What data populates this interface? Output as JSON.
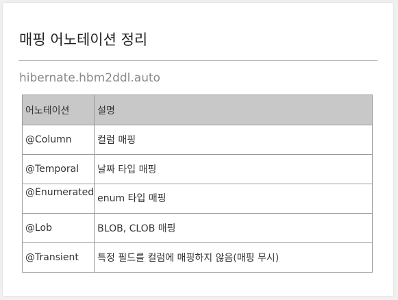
{
  "heading": "매핑 어노테이션 정리",
  "subheading": "hibernate.hbm2ddl.auto",
  "table": {
    "headers": [
      "어노테이션",
      "설명"
    ],
    "rows": [
      [
        "@Column",
        "컬럼 매핑"
      ],
      [
        "@Temporal",
        "날짜 타입 매핑"
      ],
      [
        "@Enumerated",
        "enum 타입 매핑"
      ],
      [
        "@Lob",
        "BLOB, CLOB 매핑"
      ],
      [
        "@Transient",
        "특정 필드를 컬럼에 매핑하지 않음(매핑 무시)"
      ]
    ]
  }
}
